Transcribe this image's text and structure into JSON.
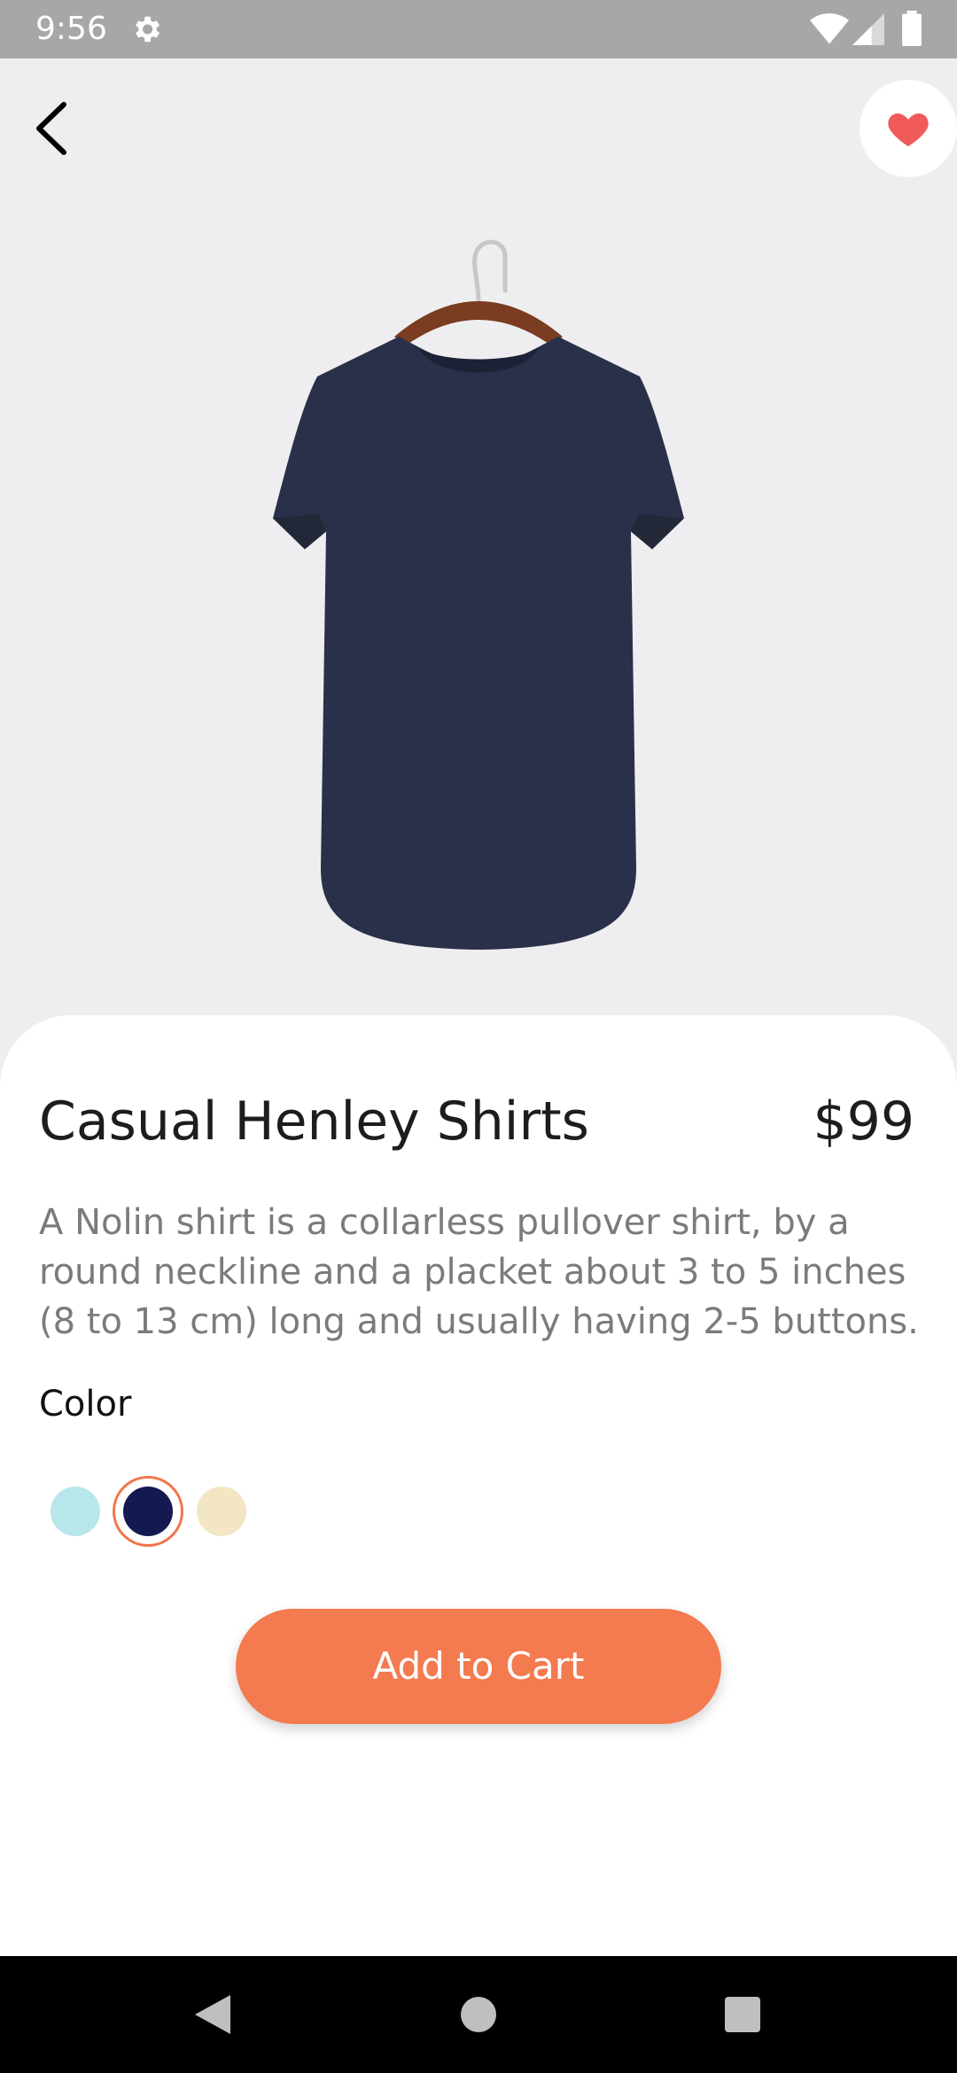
{
  "status_bar": {
    "time": "9:56"
  },
  "product": {
    "title": "Casual Henley Shirts",
    "price": "$99",
    "description": "A Nolin shirt is a collarless pullover shirt, by a round neckline and a placket about 3 to 5 inches (8 to 13 cm) long and usually having 2-5 buttons."
  },
  "color_section": {
    "label": "Color",
    "options": [
      "#b8e6ea",
      "#141a4f",
      "#f2e6c4"
    ],
    "selected_index": 1,
    "selection_ring_color": "#f0764a"
  },
  "actions": {
    "add_to_cart": "Add to Cart"
  },
  "colors": {
    "accent": "#f47a4f",
    "heart": "#f05a5a",
    "shirt": "#2a3049"
  }
}
